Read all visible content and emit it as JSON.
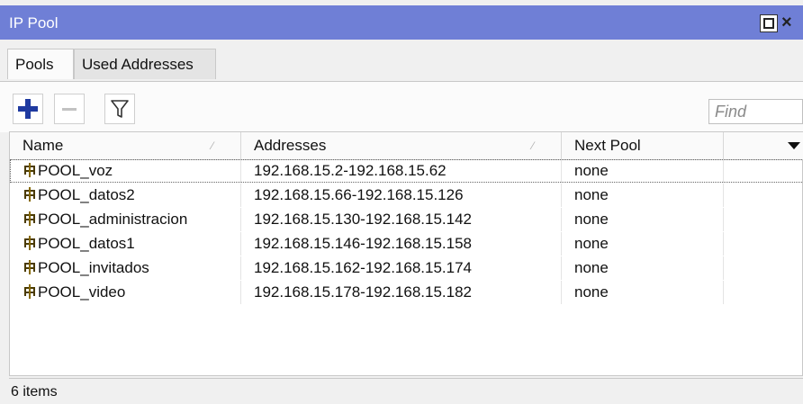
{
  "window": {
    "title": "IP Pool",
    "controls": [
      "maximize-icon",
      "close-icon"
    ],
    "accent_color": "#6f7fd6"
  },
  "tabs": [
    {
      "label": "Pools",
      "active": true
    },
    {
      "label": "Used Addresses",
      "active": false
    }
  ],
  "toolbar": {
    "add_icon": "plus-icon",
    "remove_icon": "minus-icon",
    "filter_icon": "filter-icon",
    "find_placeholder": "Find"
  },
  "table": {
    "columns": [
      "Name",
      "Addresses",
      "Next Pool",
      ""
    ],
    "rows": [
      {
        "name": "POOL_voz",
        "addresses": "192.168.15.2-192.168.15.62",
        "next_pool": "none"
      },
      {
        "name": "POOL_datos2",
        "addresses": "192.168.15.66-192.168.15.126",
        "next_pool": "none"
      },
      {
        "name": "POOL_administracion",
        "addresses": "192.168.15.130-192.168.15.142",
        "next_pool": "none"
      },
      {
        "name": "POOL_datos1",
        "addresses": "192.168.15.146-192.168.15.158",
        "next_pool": "none"
      },
      {
        "name": "POOL_invitados",
        "addresses": "192.168.15.162-192.168.15.174",
        "next_pool": "none"
      },
      {
        "name": "POOL_video",
        "addresses": "192.168.15.178-192.168.15.182",
        "next_pool": "none"
      }
    ]
  },
  "status": {
    "items_text": "6 items"
  }
}
